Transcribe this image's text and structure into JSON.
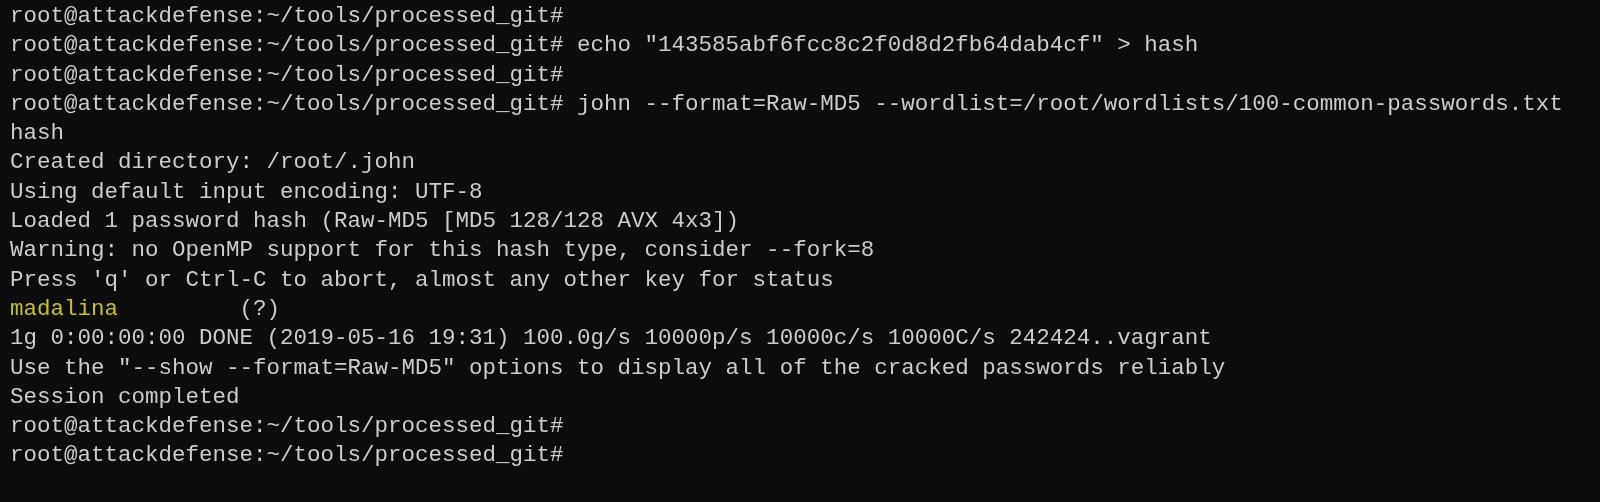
{
  "terminal": {
    "lines": [
      {
        "segments": [
          {
            "text": "root@attackdefense:~/tools/processed_git#",
            "color": "#cccccc"
          }
        ]
      },
      {
        "segments": [
          {
            "text": "root@attackdefense:~/tools/processed_git# echo \"143585abf6fcc8c2f0d8d2fb64dab4cf\" > hash",
            "color": "#cccccc"
          }
        ]
      },
      {
        "segments": [
          {
            "text": "root@attackdefense:~/tools/processed_git#",
            "color": "#cccccc"
          }
        ]
      },
      {
        "segments": [
          {
            "text": "root@attackdefense:~/tools/processed_git# john --format=Raw-MD5 --wordlist=/root/wordlists/100-common-passwords.txt",
            "color": "#cccccc"
          }
        ]
      },
      {
        "segments": [
          {
            "text": "hash",
            "color": "#cccccc"
          }
        ]
      },
      {
        "segments": [
          {
            "text": "Created directory: /root/.john",
            "color": "#cccccc"
          }
        ]
      },
      {
        "segments": [
          {
            "text": "Using default input encoding: UTF-8",
            "color": "#cccccc"
          }
        ]
      },
      {
        "segments": [
          {
            "text": "Loaded 1 password hash (Raw-MD5 [MD5 128/128 AVX 4x3])",
            "color": "#cccccc"
          }
        ]
      },
      {
        "segments": [
          {
            "text": "Warning: no OpenMP support for this hash type, consider --fork=8",
            "color": "#cccccc"
          }
        ]
      },
      {
        "segments": [
          {
            "text": "Press 'q' or Ctrl-C to abort, almost any other key for status",
            "color": "#cccccc"
          }
        ]
      },
      {
        "segments": [
          {
            "text": "madalina",
            "color": "#c4c41c"
          },
          {
            "text": "         (?)",
            "color": "#cccccc"
          }
        ]
      },
      {
        "segments": [
          {
            "text": "1g 0:00:00:00 DONE (2019-05-16 19:31) 100.0g/s 10000p/s 10000c/s 10000C/s 242424..vagrant",
            "color": "#cccccc"
          }
        ]
      },
      {
        "segments": [
          {
            "text": "Use the \"--show --format=Raw-MD5\" options to display all of the cracked passwords reliably",
            "color": "#cccccc"
          }
        ]
      },
      {
        "segments": [
          {
            "text": "Session completed",
            "color": "#cccccc"
          }
        ]
      },
      {
        "segments": [
          {
            "text": "root@attackdefense:~/tools/processed_git#",
            "color": "#cccccc"
          }
        ]
      },
      {
        "segments": [
          {
            "text": "root@attackdefense:~/tools/processed_git#",
            "color": "#cccccc"
          }
        ]
      }
    ]
  }
}
